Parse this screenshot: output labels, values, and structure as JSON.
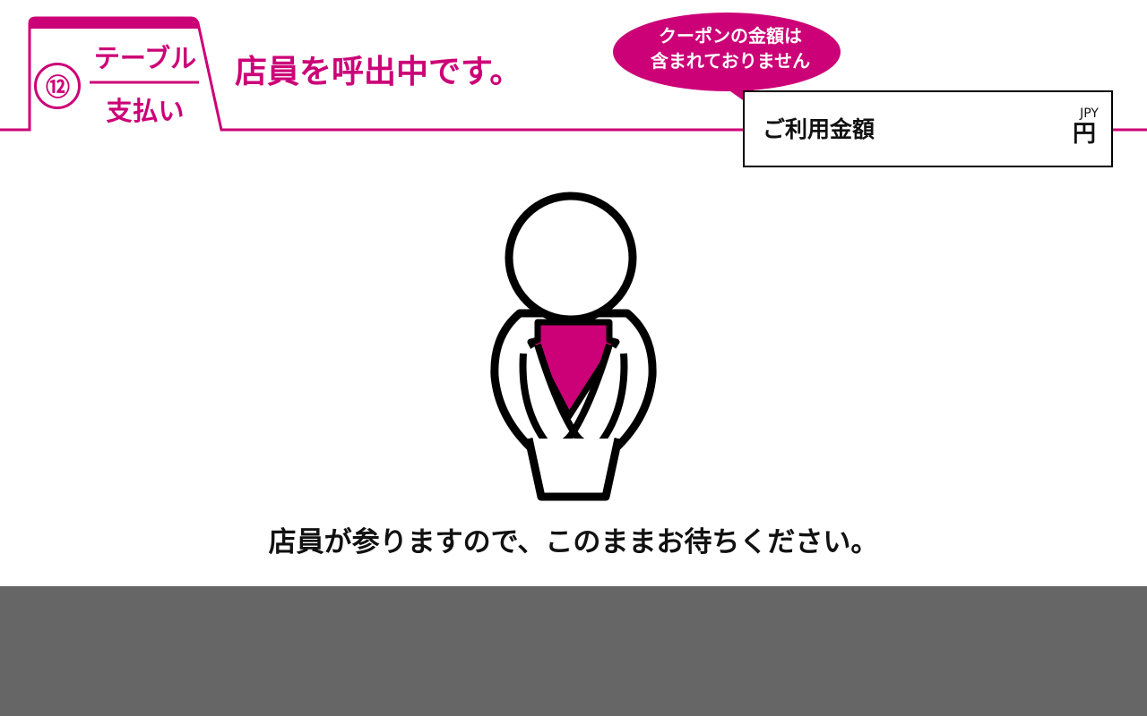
{
  "colors": {
    "accent": "#cc0077",
    "text": "#111111",
    "footer": "#666666",
    "background": "#ffffff"
  },
  "header": {
    "step_number": "⑫",
    "step_title": "テーブル",
    "step_subtitle": "支払い",
    "page_title": "店員を呼出中です。"
  },
  "coupon_notice": {
    "line1": "クーポンの金額は",
    "line2": "含まれておりません"
  },
  "amount": {
    "label": "ご利用金額",
    "value": "",
    "currency_code": "JPY",
    "currency_symbol": "円"
  },
  "illustration": {
    "icon": "bowing-staff-icon"
  },
  "message": "店員が参りますので、このままお待ちください。"
}
